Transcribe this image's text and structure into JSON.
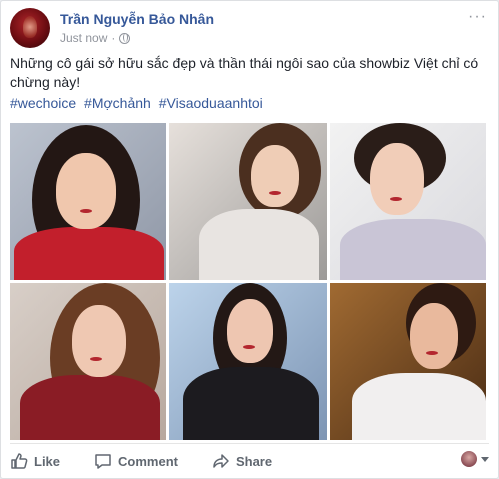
{
  "post": {
    "author_name": "Trần Nguyễn Bảo Nhân",
    "timestamp": "Just now",
    "privacy_icon": "globe-icon",
    "more_icon": "···",
    "text": "Những cô gái sở hữu sắc đẹp và thần thái ngôi sao của showbiz Việt chỉ có chừng này!",
    "hashtags": [
      "#wechoice",
      "#Mợchảnh",
      "#Visaoduaanhtoi"
    ]
  },
  "photos": [
    {
      "id": "photo-1"
    },
    {
      "id": "photo-2"
    },
    {
      "id": "photo-3"
    },
    {
      "id": "photo-4"
    },
    {
      "id": "photo-5"
    },
    {
      "id": "photo-6"
    }
  ],
  "actions": {
    "like_label": "Like",
    "comment_label": "Comment",
    "share_label": "Share"
  },
  "colors": {
    "link": "#365899",
    "text": "#1d2129",
    "meta": "#90949c",
    "action": "#606770"
  }
}
